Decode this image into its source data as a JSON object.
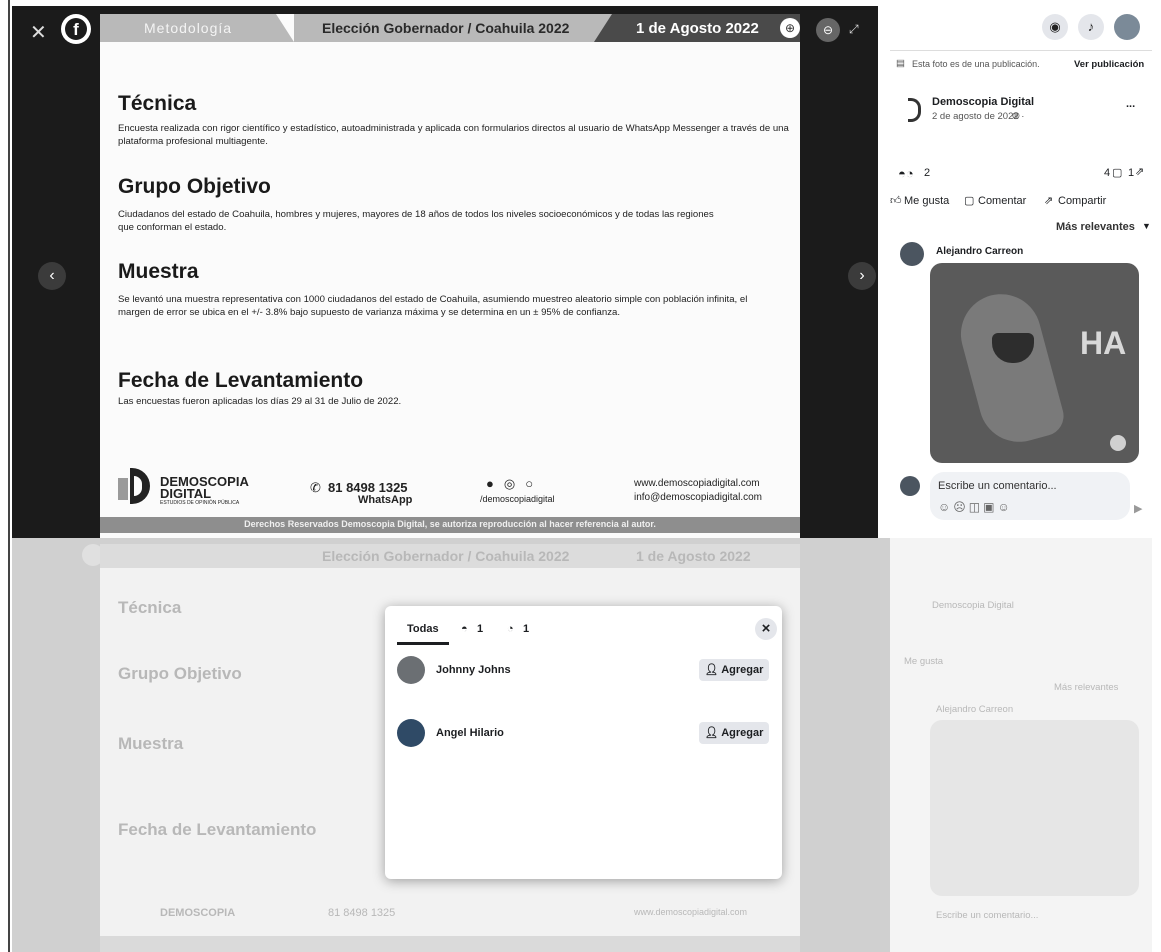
{
  "ribbon": {
    "left": "Metodología",
    "center": "Elección Gobernador / Coahuila 2022",
    "date": "1 de Agosto 2022"
  },
  "sections": [
    {
      "title": "Técnica",
      "body": "Encuesta realizada con rigor científico y estadístico, autoadministrada y aplicada con formularios directos al usuario de WhatsApp Messenger a través de una plataforma profesional multiagente."
    },
    {
      "title": "Grupo Objetivo",
      "body": "Ciudadanos del estado de Coahuila, hombres y mujeres, mayores de 18 años de todos los niveles socioeconómicos y de todas las regiones que conforman el estado."
    },
    {
      "title": "Muestra",
      "body": "Se levantó una muestra representativa con 1000 ciudadanos del estado de Coahuila, asumiendo muestreo aleatorio simple con población infinita, el margen de error se ubica en el +/- 3.8% bajo supuesto de varianza máxima y se determina en un ± 95% de confianza."
    },
    {
      "title": "Fecha de Levantamiento",
      "body": "Las encuestas fueron aplicadas los días 29 al 31 de Julio de 2022."
    }
  ],
  "footer": {
    "brand_line1": "DEMOSCOPIA",
    "brand_line2": "DIGITAL",
    "brand_tag": "ESTUDIOS DE OPINIÓN PÚBLICA",
    "phone": "81 8498 1325",
    "phone_label": "WhatsApp",
    "social_handle": "/demoscopiadigital",
    "website": "www.demoscopiadigital.com",
    "email": "info@demoscopiadigital.com",
    "rights": "Derechos Reservados Demoscopia Digital, se autoriza reproducción al hacer referencia al autor."
  },
  "fb": {
    "photo_note": "Esta foto es de una publicación.",
    "view_post": "Ver publicación",
    "page_name": "Demoscopia Digital",
    "post_date": "2 de agosto de 2022 · ",
    "more": "...",
    "reactions_count": "2",
    "comments_count": "4",
    "shares_count": "1",
    "like_label": "Me gusta",
    "comment_label": "Comentar",
    "share_label": "Compartir",
    "sort_label": "Más relevantes",
    "commenter": "Alejandro Carreon",
    "sticker_text": "HA",
    "write_comment": "Escribe un comentario..."
  },
  "modal": {
    "tabs": [
      "Todas",
      "1",
      "1"
    ],
    "close": "×",
    "people": [
      {
        "name": "Johnny Johns",
        "action": "Agregar"
      },
      {
        "name": "Angel Hilario",
        "action": "Agregar"
      }
    ]
  },
  "colors": {
    "ribbon": "#b9b9b9",
    "viewer_bg": "#1b1b1b",
    "fb_blue": "#1877f2",
    "button_bg": "#e4e6eb"
  }
}
